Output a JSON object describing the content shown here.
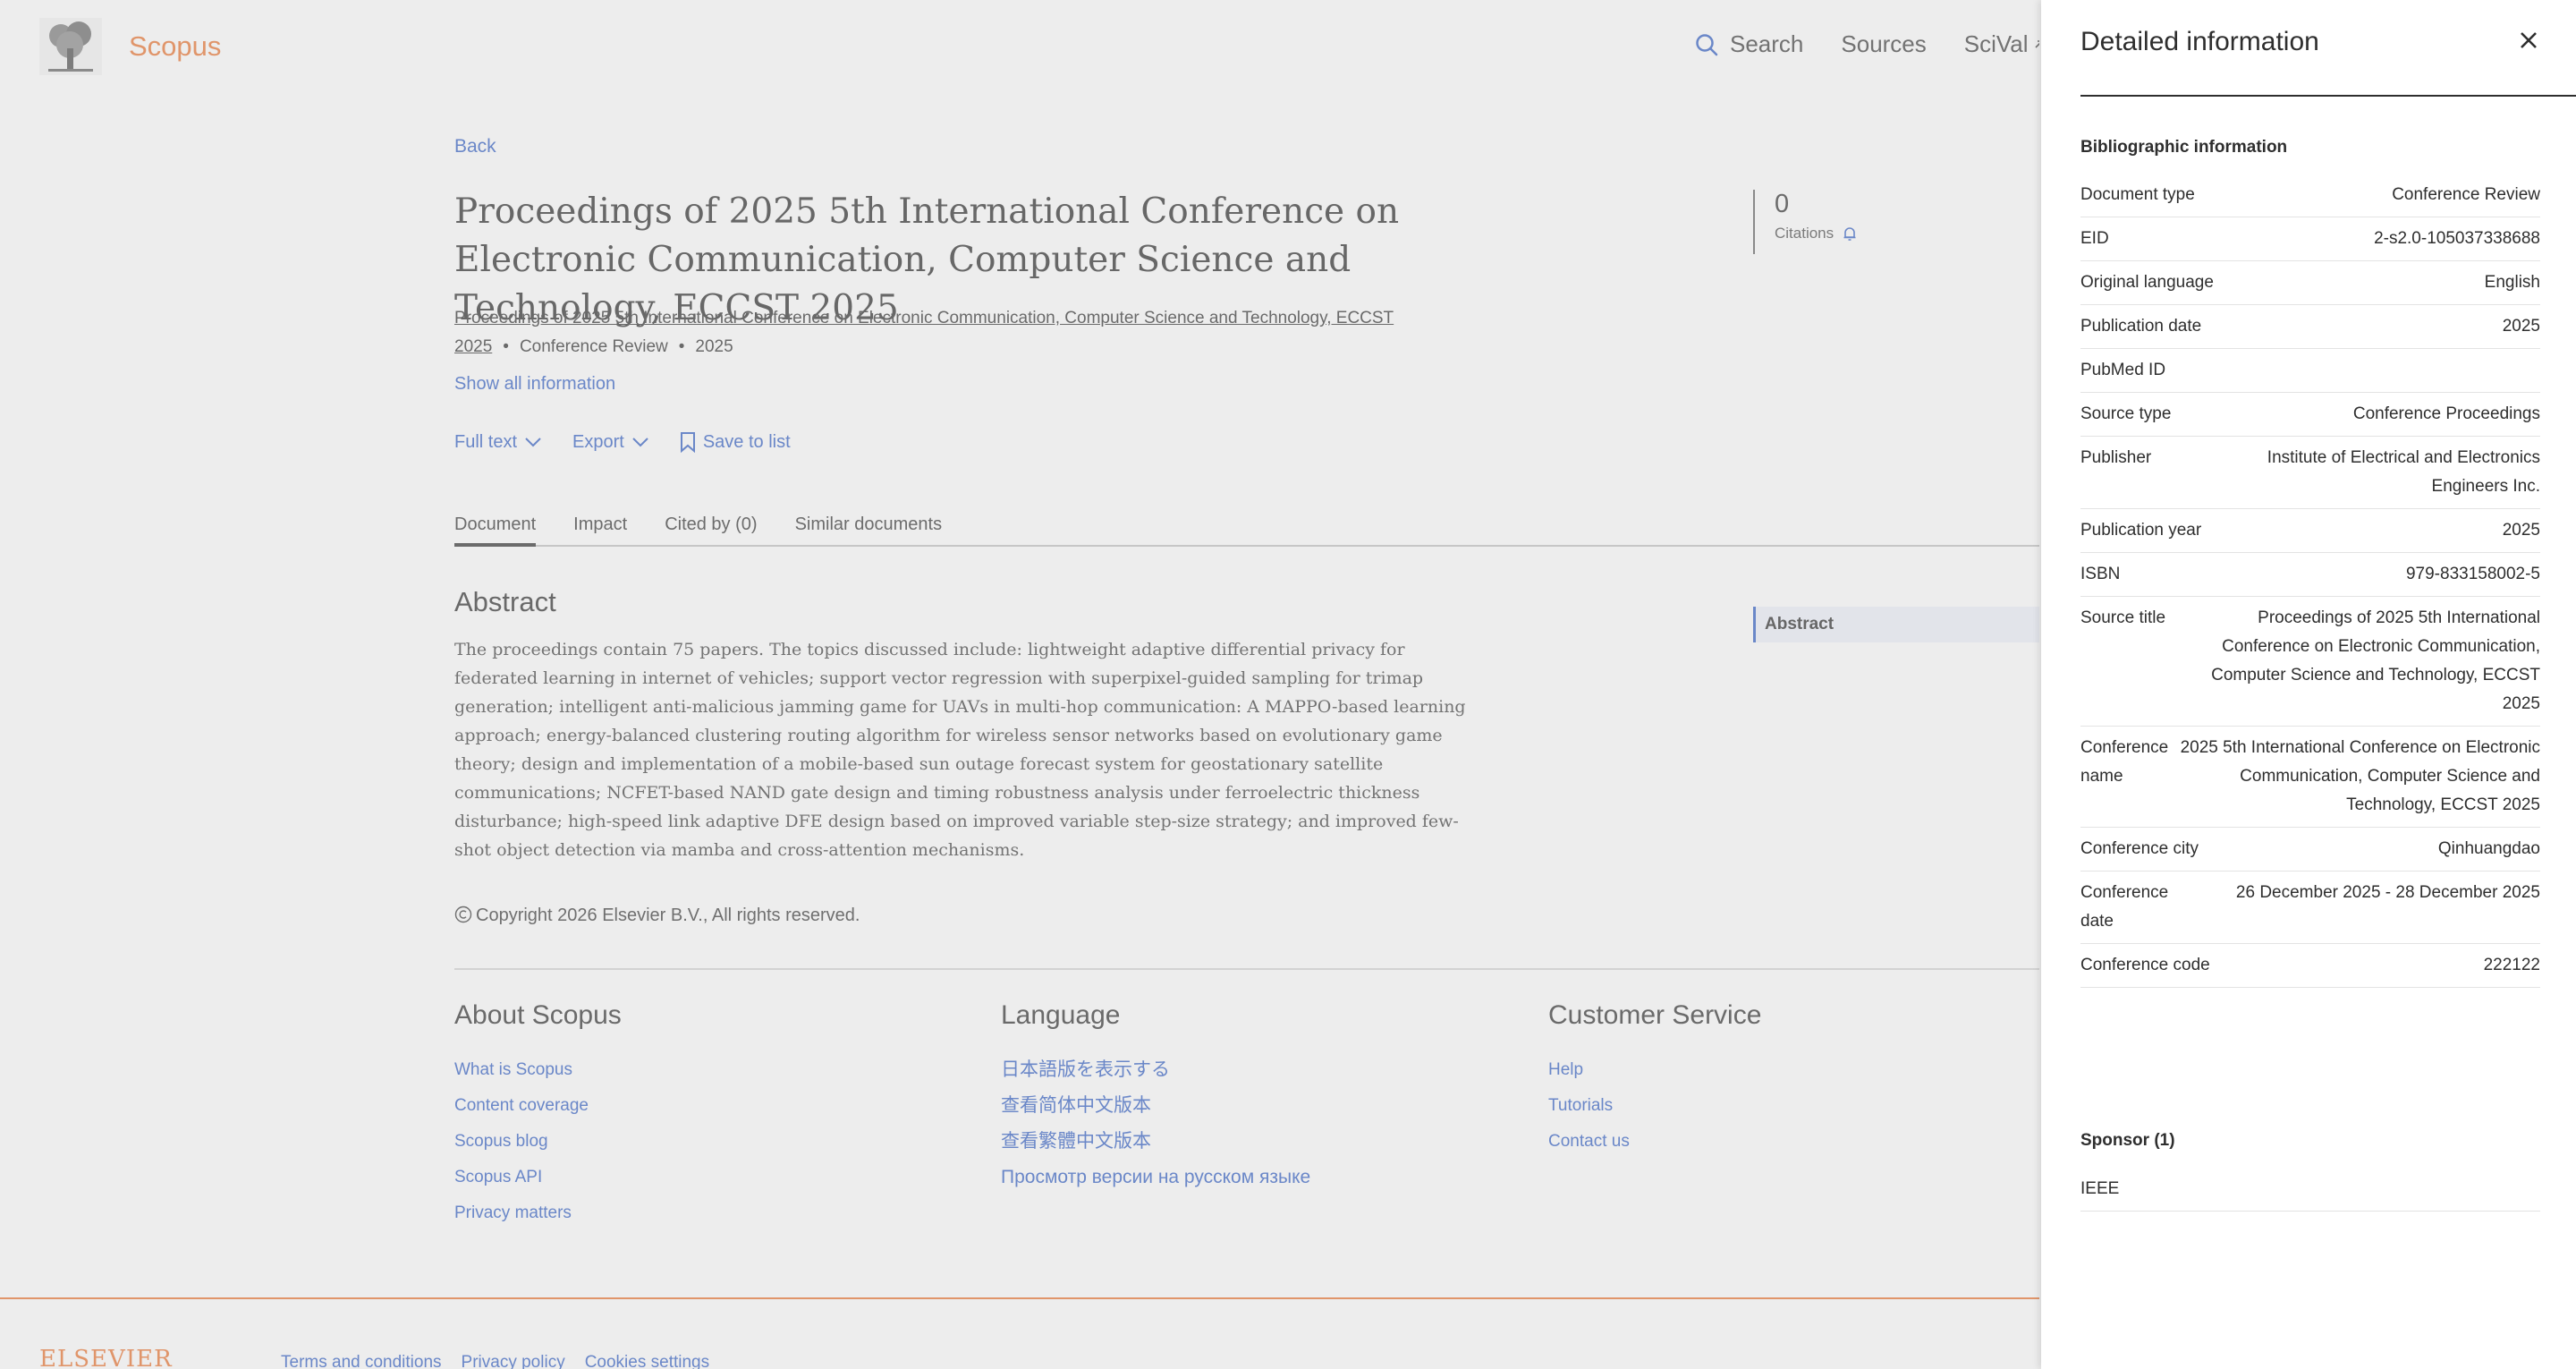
{
  "brand": {
    "name": "Scopus",
    "color": "#e0956a"
  },
  "nav": {
    "search": "Search",
    "sources": "Sources",
    "scival": "SciVal"
  },
  "document": {
    "back": "Back",
    "title": "Proceedings of 2025 5th International Conference on Electronic Communication, Computer Science and Technology, ECCST 2025",
    "source_link": "Proceedings of 2025 5th International Conference on Electronic Communication, Computer Science and Technology, ECCST 2025",
    "doc_type": "Conference Review",
    "year": "2025",
    "show_all": "Show all information",
    "citations_count": "0",
    "citations_label": "Citations",
    "actions": {
      "full_text": "Full text",
      "export": "Export",
      "save": "Save to list"
    },
    "tabs": [
      "Document",
      "Impact",
      "Cited by (0)",
      "Similar documents"
    ],
    "abstract_heading": "Abstract",
    "abstract_text": "The proceedings contain 75 papers. The topics discussed include: lightweight adaptive differential privacy for federated learning in internet of vehicles; support vector regression with superpixel-guided sampling for trimap generation; intelligent anti-malicious jamming game for UAVs in multi-hop communication: A MAPPO-based learning approach; energy-balanced clustering routing algorithm for wireless sensor networks based on evolutionary game theory; design and implementation of a mobile-based sun outage forecast system for geostationary satellite communications; NCFET-based NAND gate design and timing robustness analysis under ferroelectric thickness disturbance; high-speed link adaptive DFE design based on improved variable step-size strategy; and improved few-shot object detection via mamba and cross-attention mechanisms.",
    "toc_abstract": "Abstract",
    "copyright": "Copyright 2026 Elsevier B.V., All rights reserved."
  },
  "footer": {
    "about": {
      "heading": "About Scopus",
      "links": [
        "What is Scopus",
        "Content coverage",
        "Scopus blog",
        "Scopus API",
        "Privacy matters"
      ]
    },
    "language": {
      "heading": "Language",
      "links": [
        "日本語版を表示する",
        "查看简体中文版本",
        "查看繁體中文版本",
        "Просмотр версии на русском языке"
      ]
    },
    "service": {
      "heading": "Customer Service",
      "links": [
        "Help",
        "Tutorials",
        "Contact us"
      ]
    },
    "elsevier": "ELSEVIER",
    "bottom_links": [
      "Terms and conditions",
      "Privacy policy",
      "Cookies settings"
    ]
  },
  "panel": {
    "title": "Detailed information",
    "bib_heading": "Bibliographic information",
    "rows": [
      {
        "label": "Document type",
        "value": "Conference Review"
      },
      {
        "label": "EID",
        "value": "2-s2.0-105037338688"
      },
      {
        "label": "Original language",
        "value": "English"
      },
      {
        "label": "Publication date",
        "value": "2025"
      },
      {
        "label": "PubMed ID",
        "value": ""
      },
      {
        "label": "Source type",
        "value": "Conference Proceedings"
      },
      {
        "label": "Publisher",
        "value": "Institute of Electrical and Electronics Engineers Inc."
      },
      {
        "label": "Publication year",
        "value": "2025"
      },
      {
        "label": "ISBN",
        "value": "979-833158002-5"
      },
      {
        "label": "Source title",
        "value": "Proceedings of 2025 5th International Conference on Electronic Communication, Computer Science and Technology, ECCST 2025"
      },
      {
        "label": "Conference name",
        "value": "2025 5th International Conference on Electronic Communication, Computer Science and Technology, ECCST 2025"
      },
      {
        "label": "Conference city",
        "value": "Qinhuangdao"
      },
      {
        "label": "Conference date",
        "value": "26 December 2025 - 28 December 2025"
      },
      {
        "label": "Conference code",
        "value": "222122"
      }
    ],
    "sponsor_heading": "Sponsor (1)",
    "sponsor": "IEEE"
  }
}
